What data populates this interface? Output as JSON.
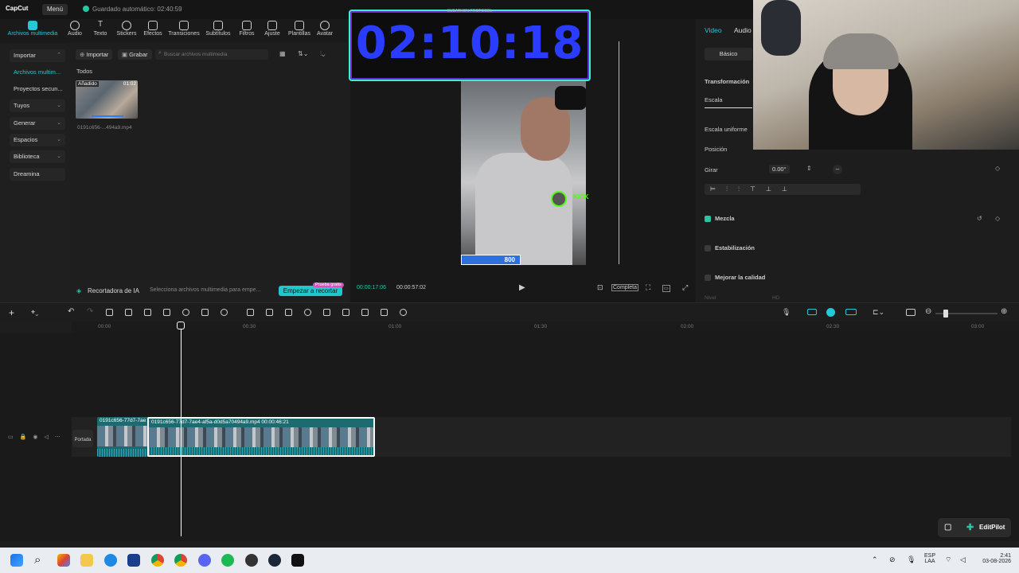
{
  "app": {
    "logo": "CapCut",
    "menu_label": "Menú",
    "autosave": "Guardado automático: 02:40:59"
  },
  "toolbar": {
    "items": [
      {
        "label": "Archivos multimedia",
        "icon": "media-icon"
      },
      {
        "label": "Audio",
        "icon": "audio-icon"
      },
      {
        "label": "Texto",
        "icon": "text-icon"
      },
      {
        "label": "Stickers",
        "icon": "sticker-icon"
      },
      {
        "label": "Efectos",
        "icon": "effects-icon"
      },
      {
        "label": "Transiciones",
        "icon": "transitions-icon"
      },
      {
        "label": "Subtítulos",
        "icon": "subtitles-icon"
      },
      {
        "label": "Filtros",
        "icon": "filters-icon"
      },
      {
        "label": "Ajuste",
        "icon": "adjust-icon"
      },
      {
        "label": "Plantillas",
        "icon": "templates-icon"
      },
      {
        "label": "Avatar",
        "icon": "avatar-icon"
      }
    ]
  },
  "leftnav": {
    "items": [
      {
        "label": "Importar"
      },
      {
        "label": "Archivos multim..."
      },
      {
        "label": "Proyectos secun..."
      },
      {
        "label": "Tuyos"
      },
      {
        "label": "Generar"
      },
      {
        "label": "Espacios"
      },
      {
        "label": "Biblioteca"
      },
      {
        "label": "Dreamina"
      }
    ]
  },
  "media": {
    "import_label": "Importar",
    "record_label": "Grabar",
    "search_placeholder": "Buscar archivos multimedia",
    "filter_all": "Todos",
    "item": {
      "tag": "Añadido",
      "duration": "01:02",
      "name": "0191c656-...494a9.mp4"
    }
  },
  "aibar": {
    "title": "Recortadora de IA",
    "hint": "Selecciona archivos multimedia para empe...",
    "button": "Empezar a recortar",
    "badge": "Prueba gratis"
  },
  "preview": {
    "timer": "02:10:18",
    "timer_sub": "SUBATHON PROTOCOL",
    "current_time": "00:00:17:06",
    "total_time": "00:00:57:02",
    "bar_value": "800",
    "kick_label": "KICK",
    "full_label": "Completa"
  },
  "props": {
    "tabs": [
      "Video",
      "Audio"
    ],
    "basic_tab": "Básico",
    "transform": "Transformación",
    "scale": "Escala",
    "uniform_scale": "Escala uniforme",
    "position": "Posición",
    "rotate": "Girar",
    "rotate_value": "0.00°",
    "blend": "Mezcla",
    "stabilize": "Estabilización",
    "enhance": "Mejorar la calidad",
    "enhance_quality": "HD",
    "normal": "Nivel"
  },
  "timeline": {
    "ticks": [
      "00:00",
      "00:30",
      "01:00",
      "01:30",
      "02:00",
      "02:30",
      "03:00"
    ],
    "clip1_title": "0191c656-77d7-7ae",
    "clip2_title": "0191c656-77d7-7ae4-af5a-d0d5a70494a9.mp4   00:00:46:21",
    "cover_label": "Portada"
  },
  "editpilot": {
    "label": "EditPilot"
  },
  "taskbar": {
    "lang1": "ESP",
    "lang2": "LAA",
    "time": "2:41",
    "date": "03-08-2026"
  }
}
